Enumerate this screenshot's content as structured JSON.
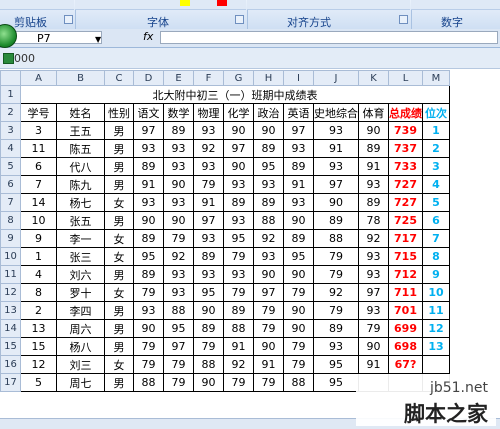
{
  "ribbon": {
    "groups": [
      "剪贴板",
      "字体",
      "对齐方式",
      "数字"
    ]
  },
  "formula_bar": {
    "name_box": "P7",
    "fx_label": "fx",
    "value": ""
  },
  "workbook": {
    "title": "000"
  },
  "columns": [
    "A",
    "B",
    "C",
    "D",
    "E",
    "F",
    "G",
    "H",
    "I",
    "J",
    "K",
    "L",
    "M"
  ],
  "sheet": {
    "title": "北大附中初三（一）班期中成绩表",
    "headers": [
      "学号",
      "姓名",
      "性别",
      "语文",
      "数学",
      "物理",
      "化学",
      "政治",
      "英语",
      "史地综合",
      "体育",
      "总成绩",
      "位次"
    ],
    "rows": [
      [
        "3",
        "王五",
        "男",
        "97",
        "89",
        "93",
        "90",
        "90",
        "97",
        "93",
        "90",
        "739",
        "1"
      ],
      [
        "11",
        "陈五",
        "男",
        "93",
        "93",
        "92",
        "97",
        "89",
        "93",
        "91",
        "89",
        "737",
        "2"
      ],
      [
        "6",
        "代八",
        "男",
        "89",
        "93",
        "93",
        "90",
        "95",
        "89",
        "93",
        "91",
        "733",
        "3"
      ],
      [
        "7",
        "陈九",
        "男",
        "91",
        "90",
        "79",
        "93",
        "93",
        "91",
        "97",
        "93",
        "727",
        "4"
      ],
      [
        "14",
        "杨七",
        "女",
        "93",
        "93",
        "91",
        "89",
        "89",
        "93",
        "90",
        "89",
        "727",
        "5"
      ],
      [
        "10",
        "张五",
        "男",
        "90",
        "90",
        "97",
        "93",
        "88",
        "90",
        "89",
        "78",
        "725",
        "6"
      ],
      [
        "9",
        "李一",
        "女",
        "89",
        "79",
        "93",
        "95",
        "92",
        "89",
        "88",
        "92",
        "717",
        "7"
      ],
      [
        "1",
        "张三",
        "女",
        "95",
        "92",
        "89",
        "79",
        "93",
        "95",
        "79",
        "93",
        "715",
        "8"
      ],
      [
        "4",
        "刘六",
        "男",
        "89",
        "93",
        "93",
        "93",
        "90",
        "90",
        "79",
        "93",
        "712",
        "9"
      ],
      [
        "8",
        "罗十",
        "女",
        "79",
        "93",
        "95",
        "79",
        "97",
        "79",
        "92",
        "97",
        "711",
        "10"
      ],
      [
        "2",
        "李四",
        "男",
        "93",
        "88",
        "90",
        "89",
        "79",
        "90",
        "79",
        "93",
        "701",
        "11"
      ],
      [
        "13",
        "周六",
        "男",
        "90",
        "95",
        "89",
        "88",
        "79",
        "90",
        "89",
        "79",
        "699",
        "12"
      ],
      [
        "15",
        "杨八",
        "男",
        "79",
        "97",
        "79",
        "91",
        "90",
        "79",
        "93",
        "90",
        "698",
        "13"
      ],
      [
        "12",
        "刘三",
        "女",
        "79",
        "79",
        "88",
        "92",
        "91",
        "79",
        "95",
        "91",
        "67?",
        ""
      ],
      [
        "5",
        "周七",
        "男",
        "88",
        "79",
        "90",
        "79",
        "79",
        "88",
        "95",
        "",
        "",
        ""
      ]
    ]
  },
  "watermark": {
    "url": "jb51.net",
    "name": "脚本之家"
  }
}
